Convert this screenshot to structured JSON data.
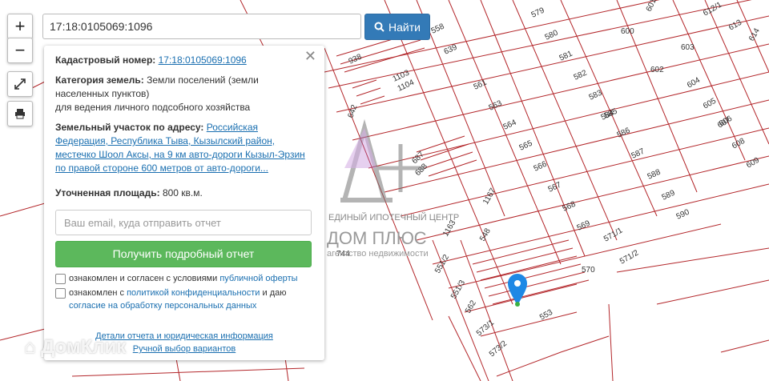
{
  "search": {
    "value": "17:18:0105069:1096",
    "button_label": "Найти"
  },
  "map_controls": {
    "zoom_in": "+",
    "zoom_out": "−"
  },
  "info": {
    "cadastral_label": "Кадастровый номер:",
    "cadastral_number": "17:18:0105069:1096",
    "category_label": "Категория земель:",
    "category_value": "Земли поселений (земли населенных пунктов)",
    "category_use": "для ведения личного подсобного хозяйства",
    "address_label": "Земельный участок по адресу:",
    "address_value": "Российская Федерация, Республика Тыва, Кызылский район, местечко Шоол Аксы, на 9 км авто-дороги Кызыл-Эрзин по правой стороне 600 метров от авто-дороги...",
    "area_label": "Уточненная площадь:",
    "area_value": "800 кв.м."
  },
  "form": {
    "email_placeholder": "Ваш email, куда отправить отчет",
    "submit_label": "Получить подробный отчет",
    "check1_text": "ознакомлен и согласен с условиями",
    "check1_link": "публичной оферты",
    "check2_text": "ознакомлен с",
    "check2_link": "политикой конфиденциальности",
    "check2_text2": "и даю",
    "check2_link2": "согласие на обработку персональных данных"
  },
  "footer": {
    "details_link": "Детали отчета и юридическая информация",
    "manual_link": "Ручной выбор вариантов"
  },
  "watermark": {
    "line1": "ЕДИНЫЙ ИПОТЕЧНЫЙ ЦЕНТР",
    "line2": "ДОМ ПЛЮС",
    "line3": "агентство недвижимости",
    "domklik": "ДомКлик"
  },
  "parcel_labels": [
    "579",
    "580",
    "581",
    "582",
    "583",
    "584",
    "585",
    "586",
    "587",
    "588",
    "589",
    "590",
    "600",
    "601",
    "602",
    "603",
    "604",
    "605",
    "606",
    "607",
    "608",
    "609",
    "612/1",
    "613",
    "614",
    "558",
    "561",
    "563",
    "564",
    "565",
    "566",
    "567",
    "568",
    "569",
    "570",
    "571/1",
    "571/2",
    "639",
    "938",
    "1103",
    "1104",
    "1167",
    "1163",
    "548",
    "551/2",
    "551/3",
    "562",
    "573/1",
    "573/2",
    "553",
    "687",
    "688",
    "744",
    "642"
  ],
  "colors": {
    "parcel_line": "#b3262a",
    "map_bg": "#ffffff",
    "accent": "#337ab7",
    "submit": "#5cb85c",
    "marker": "#1e88e5"
  }
}
